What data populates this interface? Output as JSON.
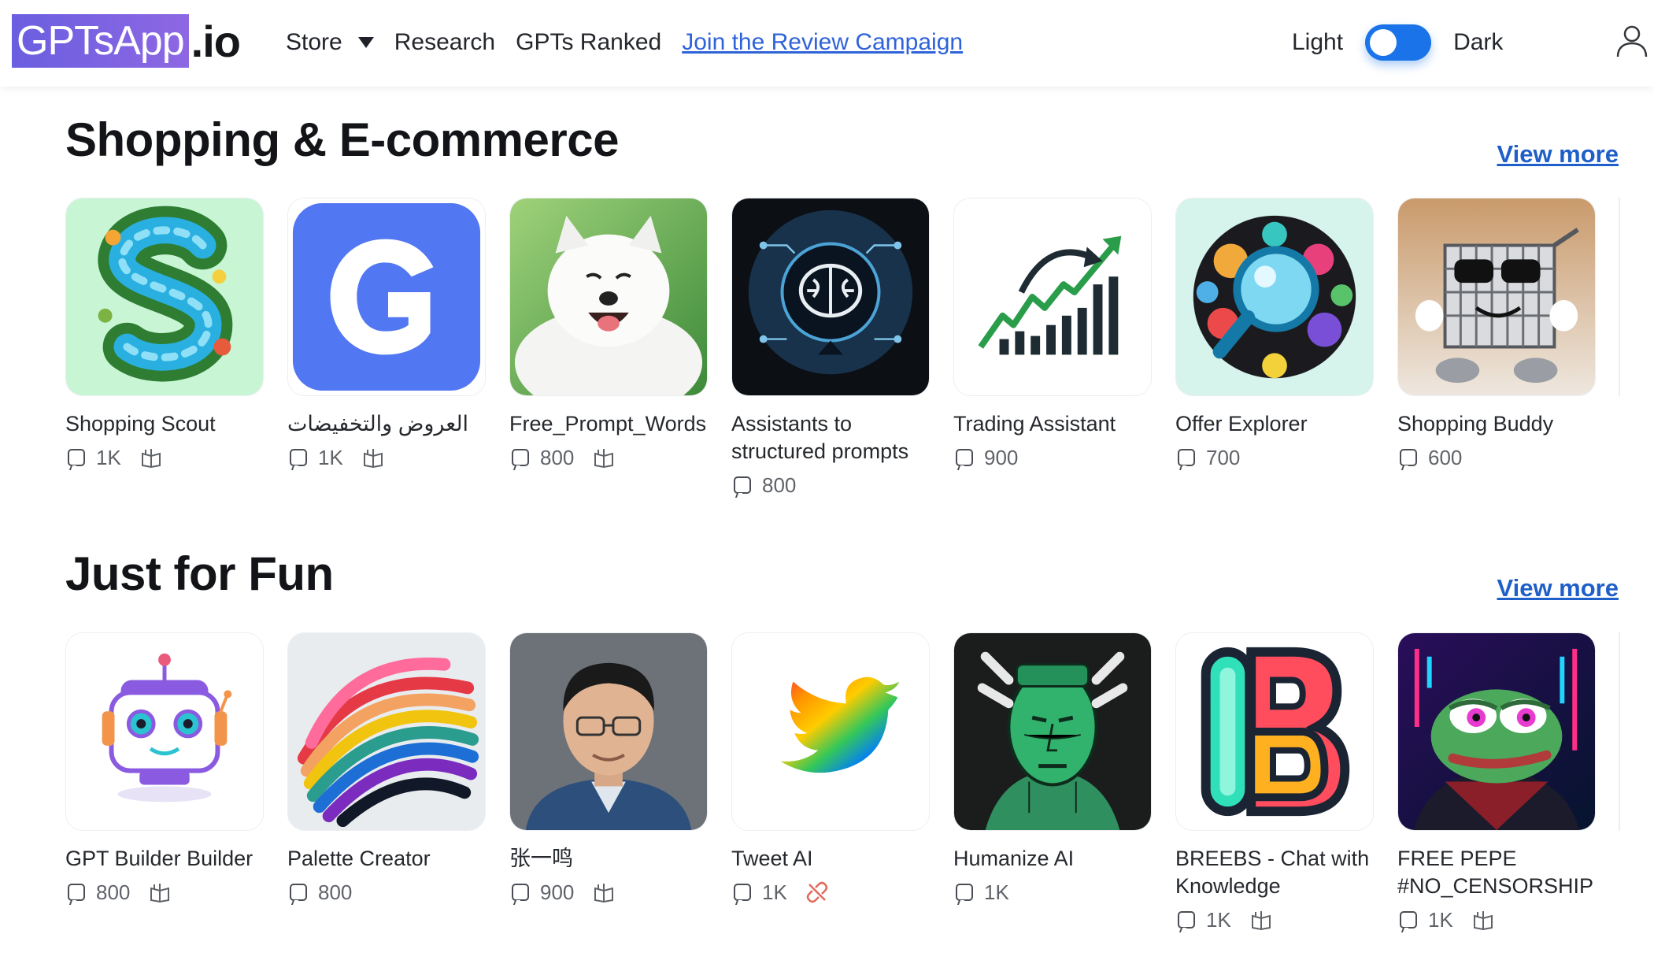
{
  "header": {
    "logo_main": "GPTsApp",
    "logo_tld": ".io",
    "nav": {
      "store": "Store",
      "research": "Research",
      "ranked": "GPTs Ranked",
      "campaign": "Join the Review Campaign"
    },
    "theme": {
      "light": "Light",
      "dark": "Dark"
    }
  },
  "sections": [
    {
      "title": "Shopping & E-commerce",
      "view_more": "View more",
      "cards": [
        {
          "name": "Shopping Scout",
          "count": "1K",
          "icon": "s-river-logo",
          "badge": "book-icon"
        },
        {
          "name": "العروض والتخفيضات",
          "count": "1K",
          "icon": "blue-g-logo",
          "badge": "book-icon"
        },
        {
          "name": "Free_Prompt_Words",
          "count": "800",
          "icon": "white-dog",
          "badge": "book-icon"
        },
        {
          "name": "Assistants to structured prompts",
          "count": "800",
          "icon": "brain-chip",
          "badge": ""
        },
        {
          "name": "Trading Assistant",
          "count": "900",
          "icon": "trend-chart",
          "badge": ""
        },
        {
          "name": "Offer Explorer",
          "count": "700",
          "icon": "magnifier-collage",
          "badge": ""
        },
        {
          "name": "Shopping Buddy",
          "count": "600",
          "icon": "cart-character",
          "badge": ""
        }
      ]
    },
    {
      "title": "Just for Fun",
      "view_more": "View more",
      "cards": [
        {
          "name": "GPT Builder Builder",
          "count": "800",
          "icon": "robot",
          "badge": "book-icon"
        },
        {
          "name": "Palette Creator",
          "count": "800",
          "icon": "color-swirl",
          "badge": ""
        },
        {
          "name": "张一鸣",
          "count": "900",
          "icon": "portrait",
          "badge": "book-icon"
        },
        {
          "name": "Tweet AI",
          "count": "1K",
          "icon": "rainbow-bird",
          "badge": "broken-link-icon"
        },
        {
          "name": "Humanize AI",
          "count": "1K",
          "icon": "green-head",
          "badge": ""
        },
        {
          "name": "BREEBS - Chat with Knowledge",
          "count": "1K",
          "icon": "letter-b-logo",
          "badge": "book-icon"
        },
        {
          "name": "FREE PEPE #NO_CENSORSHIP",
          "count": "1K",
          "icon": "neon-frog",
          "badge": "book-icon"
        }
      ]
    }
  ],
  "colors": {
    "accent": "#1a73e8",
    "link": "#2f63d8",
    "logo": "#7b63e2"
  }
}
